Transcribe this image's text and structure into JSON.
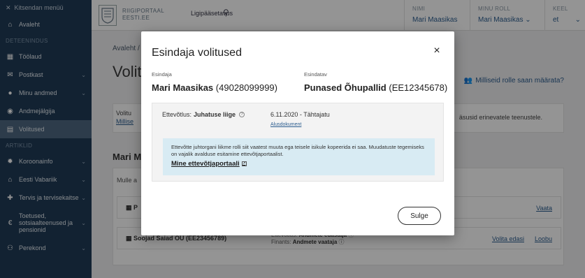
{
  "sidebar": {
    "close_menu": "Kitsendan menüü",
    "home": "Avaleht",
    "section_service": "DETEENINDUS",
    "items": [
      {
        "label": "Töölaud",
        "chevron": false
      },
      {
        "label": "Postkast",
        "chevron": true
      },
      {
        "label": "Minu andmed",
        "chevron": true
      },
      {
        "label": "Andmejälgija",
        "chevron": false
      },
      {
        "label": "Volitused",
        "chevron": false
      }
    ],
    "section_articles": "ARTIKLID",
    "articles": [
      {
        "label": "Koroonainfo",
        "chevron": true
      },
      {
        "label": "Eesti Vabariik",
        "chevron": true
      },
      {
        "label": "Tervis ja tervisekaitse",
        "chevron": true
      },
      {
        "label": "Toetused, sotsiaalteenused ja pensionid",
        "chevron": true
      },
      {
        "label": "Perekond",
        "chevron": true
      }
    ]
  },
  "topbar": {
    "portal_line1": "RIIGIPORTAAL",
    "portal_line2": "EESTI.EE",
    "accessibility": "Ligipääsetavus",
    "name_header": "NIMI",
    "name_value": "Mari Maasikas",
    "role_header": "MINU ROLL",
    "role_value": "Mari Maasikas",
    "lang_header": "KEEL",
    "lang_value": "et"
  },
  "page": {
    "breadcrumb": "Avaleht /",
    "title": "Volit",
    "roles_link": "Milliseid rolle saan määrata?",
    "info_text": "Volitu",
    "info_link": "Millise",
    "info_right": "äsusid erinevatele teenustele.",
    "sub_title": "Mari Ma",
    "list_header": "Mulle a",
    "rows": [
      {
        "name": "P",
        "mid1": "",
        "mid2": "",
        "actions": [
          "Vaata"
        ]
      },
      {
        "name": "Soojad Saiad OÜ (EE23456789)",
        "mid1_label": "Ettevõtlus: ",
        "mid1_value": "Andmete edastaja",
        "mid2_label": "Finants: ",
        "mid2_value": "Andmete vaataja",
        "actions": [
          "Volita edasi",
          "Loobu"
        ]
      }
    ]
  },
  "modal": {
    "title": "Esindaja volitused",
    "close_icon": "×",
    "rep_label": "Esindaja",
    "rep_name": "Mari Maasikas",
    "rep_code": "(49028099999)",
    "represented_label": "Esindatav",
    "represented_name": "Punased Õhupallid",
    "represented_code": "(EE12345678)",
    "role_label": "Ettevõtlus: ",
    "role_value": "Juhatuse liige",
    "validity": "6.11.2020 - Tähtajatu",
    "doc_link": "Alusdokument",
    "notice": "Ettevõtte juhtorgani liikme rolli siit vaatest muuta ega teisele isikule kopeerida ei saa. Muudatuste tegemiseks on vajalik avalduse esitamine ettevõtjaportaalist.",
    "notice_link": "Mine ettevõtjaportaali",
    "close_button": "Sulge"
  },
  "colors": {
    "sidebar_bg": "#1f3b57",
    "accent_link": "#2c5d8f",
    "notice_bg": "#d8ebf3"
  }
}
